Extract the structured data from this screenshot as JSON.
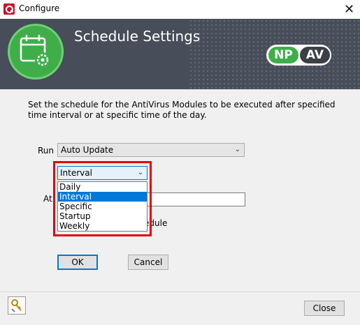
{
  "window": {
    "title": "Configure",
    "close_glyph": "✕"
  },
  "header": {
    "title": "Schedule Settings",
    "icon": "calendar-gear-icon",
    "logo_left": "NP",
    "logo_right": "AV"
  },
  "description": "Set the schedule for the AntiVirus Modules to be executed after specified time interval or at specific time of the day.",
  "run": {
    "label": "Run",
    "value": "Auto Update"
  },
  "schedule_type": {
    "value": "Interval",
    "options": [
      "Daily",
      "Interval",
      "Specific",
      "Startup",
      "Weekly"
    ],
    "selected": "Interval"
  },
  "at": {
    "label": "At",
    "value": ""
  },
  "partial_label": "edule",
  "buttons": {
    "ok": "OK",
    "cancel": "Cancel",
    "close": "Close"
  },
  "colors": {
    "banner": "#474d59",
    "accent_green": "#3fae49",
    "highlight_red": "#e3000f",
    "selection_blue": "#0078d7"
  }
}
